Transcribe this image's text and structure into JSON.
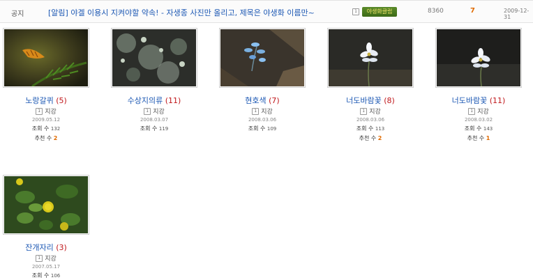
{
  "notice": {
    "label": "공지",
    "title": "[알림] 야겔 이용시 지켜야할 약속! - 자생종 사진만 올리고, 제목은 야생화 이름만~",
    "author_badge": "야생화클럽",
    "views": "8360",
    "likes": "7",
    "date": "2009-12-31"
  },
  "level_icon_glyph": "1",
  "labels": {
    "views": "조회 수",
    "recommend": "추천 수"
  },
  "posts": [
    {
      "title": "노랑갈퀴",
      "comments": "(5)",
      "author": "지강",
      "date": "2009.05.12",
      "views": "132",
      "recommend": "2"
    },
    {
      "title": "수상지의류",
      "comments": "(11)",
      "author": "지강",
      "date": "2008.03.07",
      "views": "119",
      "recommend": null
    },
    {
      "title": "현호색",
      "comments": "(7)",
      "author": "지강",
      "date": "2008.03.06",
      "views": "109",
      "recommend": null
    },
    {
      "title": "너도바람꽃",
      "comments": "(8)",
      "author": "지강",
      "date": "2008.03.06",
      "views": "113",
      "recommend": "2"
    },
    {
      "title": "너도바람꽃",
      "comments": "(11)",
      "author": "지강",
      "date": "2008.03.02",
      "views": "143",
      "recommend": "1"
    },
    {
      "title": "잔개자리",
      "comments": "(3)",
      "author": "지강",
      "date": "2007.05.17",
      "views": "106",
      "recommend": null
    }
  ],
  "colors": {
    "link": "#1b57b3",
    "comment_count": "#c0171b",
    "accent": "#e06a00"
  }
}
